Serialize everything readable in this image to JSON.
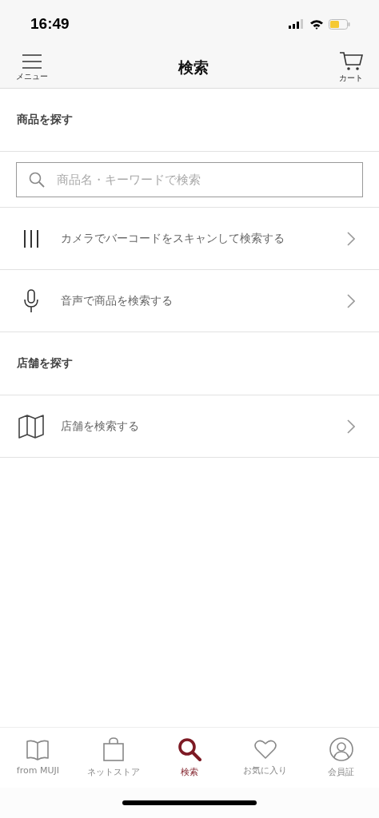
{
  "status_bar": {
    "time": "16:49"
  },
  "header": {
    "menu_label": "メニュー",
    "title": "検索",
    "cart_label": "カート"
  },
  "sections": [
    {
      "title": "商品を探す",
      "items": [
        {
          "kind": "search",
          "placeholder": "商品名・キーワードで検索"
        },
        {
          "kind": "barcode",
          "label": "カメラでバーコードをスキャンして検索する"
        },
        {
          "kind": "microphone",
          "label": "音声で商品を検索する"
        }
      ]
    },
    {
      "title": "店舗を探す",
      "items": [
        {
          "kind": "map",
          "label": "店舗を検索する"
        }
      ]
    }
  ],
  "tabs": [
    {
      "kind": "book",
      "label": "from MUJI",
      "selected": false
    },
    {
      "kind": "bag",
      "label": "ネットストア",
      "selected": false
    },
    {
      "kind": "search",
      "label": "検索",
      "selected": true
    },
    {
      "kind": "heart",
      "label": "お気に入り",
      "selected": false
    },
    {
      "kind": "person",
      "label": "会員証",
      "selected": false
    }
  ]
}
